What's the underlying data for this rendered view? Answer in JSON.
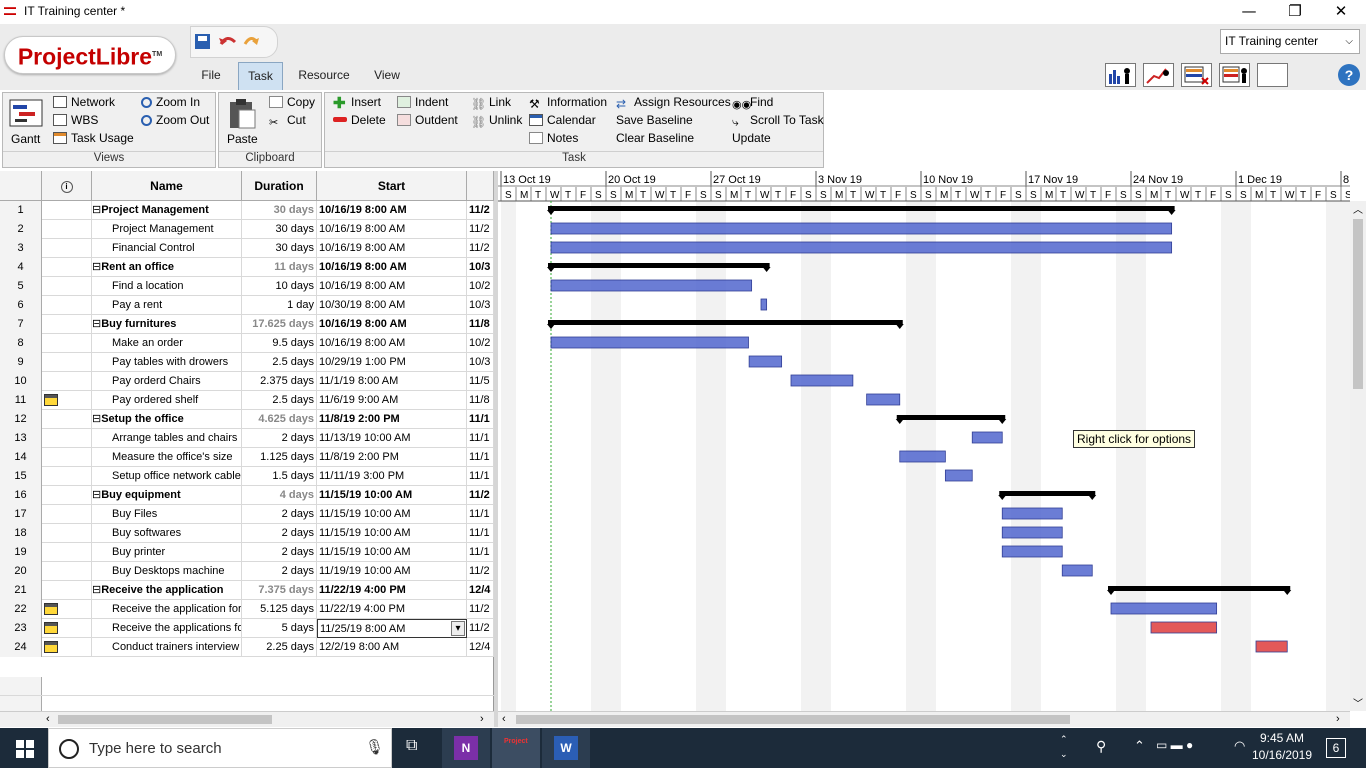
{
  "window": {
    "title": "IT Training center *",
    "minimize": "—",
    "maximize": "❐",
    "close": "✕"
  },
  "logo": {
    "text": "ProjectLibre",
    "tm": "TM"
  },
  "menu": {
    "file": "File",
    "task": "Task",
    "resource": "Resource",
    "view": "View"
  },
  "project_select": {
    "value": "IT Training center"
  },
  "ribbon": {
    "views": {
      "label": "Views",
      "gantt": "Gantt",
      "network": "Network",
      "wbs": "WBS",
      "task_usage": "Task Usage",
      "zoom_in": "Zoom In",
      "zoom_out": "Zoom Out"
    },
    "clipboard": {
      "label": "Clipboard",
      "paste": "Paste",
      "copy": "Copy",
      "cut": "Cut"
    },
    "task": {
      "label": "Task",
      "insert": "Insert",
      "delete": "Delete",
      "indent": "Indent",
      "outdent": "Outdent",
      "link": "Link",
      "unlink": "Unlink",
      "information": "Information",
      "calendar": "Calendar",
      "notes": "Notes",
      "assign_resources": "Assign Resources",
      "save_baseline": "Save Baseline",
      "clear_baseline": "Clear Baseline",
      "find": "Find",
      "scroll_to_task": "Scroll To Task",
      "update": "Update"
    }
  },
  "grid": {
    "columns": {
      "name": "Name",
      "duration": "Duration",
      "start": "Start"
    },
    "rows": [
      {
        "id": "1",
        "name": "Project Management",
        "duration": "30 days",
        "start": "10/16/19 8:00 AM",
        "finish": "11/2",
        "summary": true,
        "icon": false
      },
      {
        "id": "2",
        "name": "Project Management",
        "duration": "30 days",
        "start": "10/16/19 8:00 AM",
        "finish": "11/2",
        "summary": false,
        "icon": false
      },
      {
        "id": "3",
        "name": "Financial Control",
        "duration": "30 days",
        "start": "10/16/19 8:00 AM",
        "finish": "11/2",
        "summary": false,
        "icon": false
      },
      {
        "id": "4",
        "name": "Rent an office",
        "duration": "11 days",
        "start": "10/16/19 8:00 AM",
        "finish": "10/3",
        "summary": true,
        "icon": false
      },
      {
        "id": "5",
        "name": "Find a location",
        "duration": "10 days",
        "start": "10/16/19 8:00 AM",
        "finish": "10/2",
        "summary": false,
        "icon": false
      },
      {
        "id": "6",
        "name": "Pay a  rent",
        "duration": "1 day",
        "start": "10/30/19 8:00 AM",
        "finish": "10/3",
        "summary": false,
        "icon": false
      },
      {
        "id": "7",
        "name": "Buy furnitures",
        "duration": "17.625 days",
        "start": "10/16/19 8:00 AM",
        "finish": "11/8",
        "summary": true,
        "icon": false
      },
      {
        "id": "8",
        "name": "Make an order",
        "duration": "9.5 days",
        "start": "10/16/19 8:00 AM",
        "finish": "10/2",
        "summary": false,
        "icon": false
      },
      {
        "id": "9",
        "name": "Pay tables with drowers",
        "duration": "2.5 days",
        "start": "10/29/19 1:00 PM",
        "finish": "10/3",
        "summary": false,
        "icon": false
      },
      {
        "id": "10",
        "name": "Pay orderd  Chairs",
        "duration": "2.375 days",
        "start": "11/1/19 8:00 AM",
        "finish": "11/5",
        "summary": false,
        "icon": false
      },
      {
        "id": "11",
        "name": "Pay ordered  shelf",
        "duration": "2.5 days",
        "start": "11/6/19 9:00 AM",
        "finish": "11/8",
        "summary": false,
        "icon": true
      },
      {
        "id": "12",
        "name": "Setup the office",
        "duration": "4.625 days",
        "start": "11/8/19 2:00 PM",
        "finish": "11/1",
        "summary": true,
        "icon": false
      },
      {
        "id": "13",
        "name": "Arrange tables and chairs",
        "duration": "2 days",
        "start": "11/13/19 10:00 AM",
        "finish": "11/1",
        "summary": false,
        "icon": false
      },
      {
        "id": "14",
        "name": "Measure the office's size",
        "duration": "1.125 days",
        "start": "11/8/19 2:00 PM",
        "finish": "11/1",
        "summary": false,
        "icon": false
      },
      {
        "id": "15",
        "name": "Setup office network cable",
        "duration": "1.5 days",
        "start": "11/11/19 3:00 PM",
        "finish": "11/1",
        "summary": false,
        "icon": false
      },
      {
        "id": "16",
        "name": "Buy equipment",
        "duration": "4 days",
        "start": "11/15/19 10:00 AM",
        "finish": "11/2",
        "summary": true,
        "icon": false
      },
      {
        "id": "17",
        "name": "Buy Files",
        "duration": "2 days",
        "start": "11/15/19 10:00 AM",
        "finish": "11/1",
        "summary": false,
        "icon": false
      },
      {
        "id": "18",
        "name": "Buy softwares",
        "duration": "2 days",
        "start": "11/15/19 10:00 AM",
        "finish": "11/1",
        "summary": false,
        "icon": false
      },
      {
        "id": "19",
        "name": "Buy printer",
        "duration": "2 days",
        "start": "11/15/19 10:00 AM",
        "finish": "11/1",
        "summary": false,
        "icon": false
      },
      {
        "id": "20",
        "name": "Buy Desktops machine",
        "duration": "2 days",
        "start": "11/19/19 10:00 AM",
        "finish": "11/2",
        "summary": false,
        "icon": false
      },
      {
        "id": "21",
        "name": "Receive the application",
        "duration": "7.375 days",
        "start": "11/22/19 4:00 PM",
        "finish": "12/4",
        "summary": true,
        "icon": false
      },
      {
        "id": "22",
        "name": "Receive the application for",
        "duration": "5.125 days",
        "start": "11/22/19 4:00 PM",
        "finish": "11/2",
        "summary": false,
        "icon": true
      },
      {
        "id": "23",
        "name": "Receive the applications fo",
        "duration": "5 days",
        "start": "11/25/19 8:00 AM",
        "finish": "11/2",
        "summary": false,
        "icon": true,
        "editing": true
      },
      {
        "id": "24",
        "name": "Conduct trainers interview",
        "duration": "2.25 days",
        "start": "12/2/19 8:00 AM",
        "finish": "12/4",
        "summary": false,
        "icon": true
      }
    ]
  },
  "gantt": {
    "weeks": [
      "13 Oct 19",
      "20 Oct 19",
      "27 Oct 19",
      "3 Nov 19",
      "10 Nov 19",
      "17 Nov 19",
      "24 Nov 19",
      "1 Dec 19",
      "8"
    ],
    "day_letters": [
      "S",
      "M",
      "T",
      "W",
      "T",
      "F",
      "S"
    ],
    "tooltip": "Right click for options",
    "colors": {
      "bar": "#5b6fd1",
      "critical": "#e04848",
      "summary": "#000000"
    }
  },
  "taskbar": {
    "search_placeholder": "Type here to search",
    "time": "9:45 AM",
    "date": "10/16/2019",
    "notifications": "6"
  }
}
